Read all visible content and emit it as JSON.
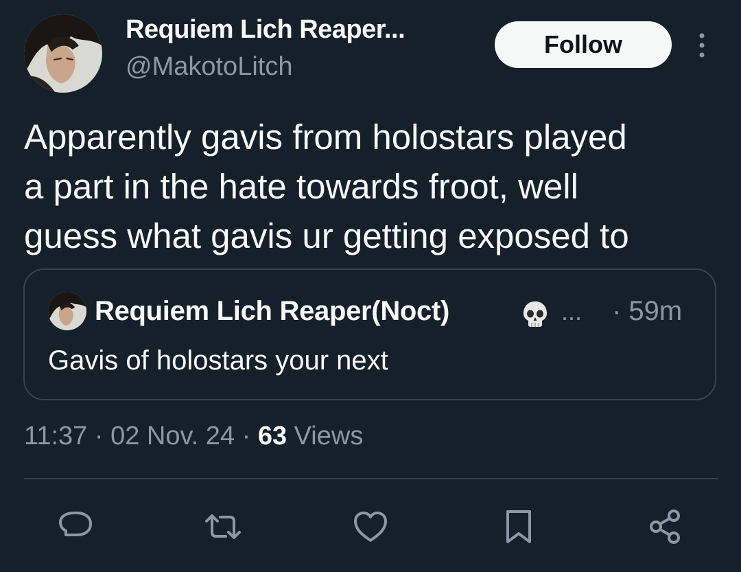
{
  "author": {
    "display_name": "Requiem Lich Reaper...",
    "handle": "@MakotoLitch"
  },
  "follow_label": "Follow",
  "tweet": {
    "lines": [
      "Apparently gavis from holostars played",
      "a part in the hate towards froot, well",
      "guess what gavis ur getting exposed to"
    ]
  },
  "quoted": {
    "display_name": "Requiem Lich Reaper(Noct)",
    "emoji_icon": "skull-icon",
    "ellipsis": "...",
    "time": "· 59m",
    "text": "Gavis of holostars your next"
  },
  "meta": {
    "time": "11:37",
    "sep1": " · ",
    "date": "02 Nov. 24",
    "sep2": " · ",
    "views_count": "63",
    "views_label": " Views"
  },
  "actions": [
    "reply-icon",
    "retweet-icon",
    "like-icon",
    "bookmark-icon",
    "share-icon"
  ],
  "colors": {
    "background": "#15202b",
    "text": "#f7f9f9",
    "secondary": "#8b98a5",
    "border": "#38444d"
  }
}
